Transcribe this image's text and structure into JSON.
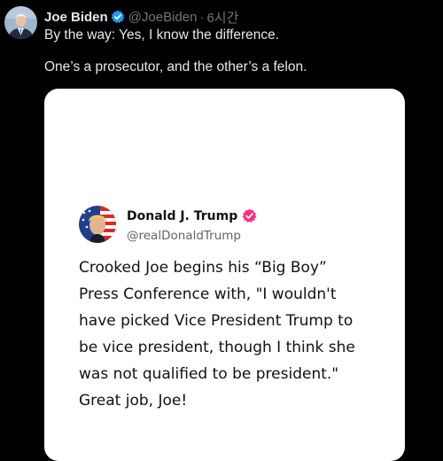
{
  "tweet": {
    "author_name": "Joe Biden",
    "author_handle": "@JoeBiden",
    "separator": "·",
    "timestamp": "6시간",
    "text_line_1": "By the way: Yes, I know the difference.",
    "text_line_2": "One’s a prosecutor, and the other’s a felon."
  },
  "embedded_post": {
    "author_name": "Donald J. Trump",
    "author_handle": "@realDonaldTrump",
    "body_lines": [
      "Crooked Joe begins his “Big Boy”",
      "Press Conference with, \"I wouldn't",
      "have picked Vice President Trump to",
      "be vice president, though I think she",
      "was not qualified to be president.\"",
      "Great job, Joe!"
    ]
  },
  "colors": {
    "background": "#000000",
    "text_primary": "#e7e9ea",
    "text_secondary": "#71767b",
    "verified_blue": "#1d9bf0",
    "truth_badge_pink": "#ff2d7d",
    "card_background": "#ffffff"
  },
  "icons": {
    "verified": "verified-badge-icon",
    "embed_badge": "pink-verified-badge-icon"
  }
}
